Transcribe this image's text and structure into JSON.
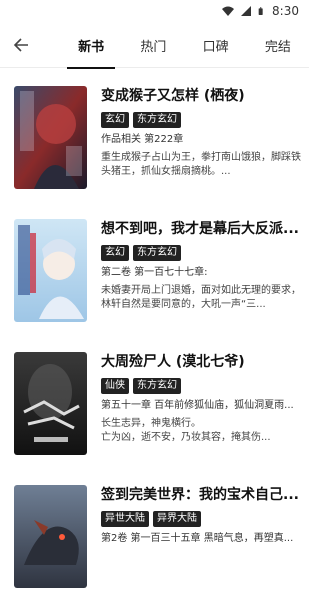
{
  "status": {
    "time": "8:30"
  },
  "header": {
    "tabs": [
      {
        "label": "新书"
      },
      {
        "label": "热门"
      },
      {
        "label": "口碑"
      },
      {
        "label": "完结"
      }
    ]
  },
  "books": [
    {
      "title": "变成猴子又怎样 (栖夜)",
      "tags": [
        "玄幻",
        "东方玄幻"
      ],
      "chapter": "作品相关 第222章",
      "desc": "重生成猴子占山为王，拳打南山饿狼，脚踩铁头猪王，抓仙女揺扇摘桃。..."
    },
    {
      "title": "想不到吧，我才是幕后大反派...",
      "tags": [
        "玄幻",
        "东方玄幻"
      ],
      "chapter": "第二卷 第一百七十七章:",
      "desc": "未婚妻开局上门退婚，面对如此无理的要求，林轩自然是要同意的，大吼一声“三..."
    },
    {
      "title": "大周殓尸人 (漠北七爷)",
      "tags": [
        "仙侠",
        "东方玄幻"
      ],
      "chapter": "第五十一章 百年前修狐仙庙，狐仙洞夏雨...",
      "desc": "长生志异，神鬼横行。\n      亡为凶，逝不安，乃妆其容，掩其伤..."
    },
    {
      "title": "签到完美世界：我的宝术自己...",
      "tags": [
        "异世大陆",
        "异界大陆"
      ],
      "chapter": "第2卷 第一百三十五章 黑暗气息，再塑真...",
      "desc": ""
    }
  ]
}
